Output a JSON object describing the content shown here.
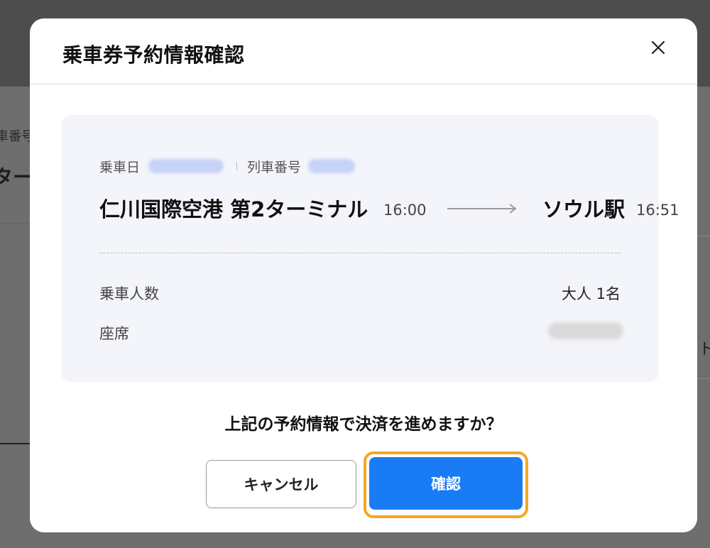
{
  "background": {
    "text_1": "車番号",
    "text_2": "ター",
    "right_char": "ト"
  },
  "modal": {
    "title": "乗車券予約情報確認",
    "close_icon": "close-icon",
    "card": {
      "ride_date_label": "乗車日",
      "train_number_label": "列車番号",
      "departure": {
        "station": "仁川国際空港 第2ターミナル",
        "time": "16:00"
      },
      "arrival": {
        "station": "ソウル駅",
        "time": "16:51"
      },
      "passengers_label": "乗車人数",
      "passengers_value": "大人 1名",
      "seat_label": "座席"
    },
    "question": "上記の予約情報で決済を進めますか？",
    "cancel_label": "キャンセル",
    "confirm_label": "確認"
  },
  "colors": {
    "primary": "#1a7cf5",
    "highlight_ring": "#f5a623",
    "card_bg": "#f3f5fa"
  }
}
